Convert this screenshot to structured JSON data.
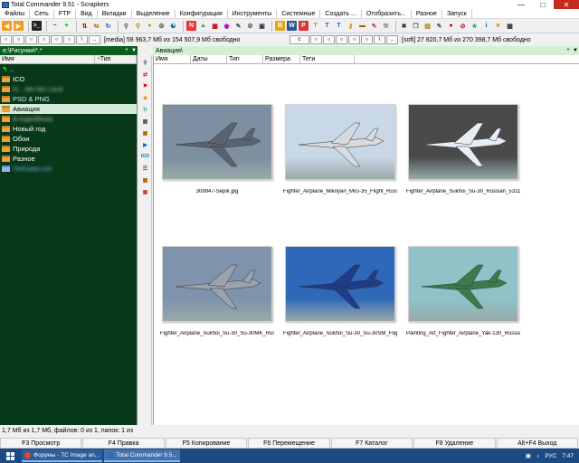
{
  "window": {
    "title": "Total Commander 9.51 - Scrapkers"
  },
  "menu": [
    "Файлы",
    "Сеть",
    "FTP",
    "Вид",
    "Вкладки",
    "Выделение",
    "Конфигурация",
    "Инструменты",
    "Системные",
    "Создать ...",
    "Отобразить...",
    "Разное",
    "Запуск"
  ],
  "left_drive": {
    "label": "c",
    "info": "[media]  58 963,7 Мб из 154 507,9 Мб свободно"
  },
  "right_drive": {
    "label": "c",
    "info": "[soft]  27 820,7 Мб из 270 398,7 Мб свободно"
  },
  "left_path": "e:\\Рисунки\\*.*",
  "right_path": "Авиация\\",
  "star_symbol": "*",
  "left_columns": {
    "name": "Имя",
    "type": "Тип"
  },
  "right_columns": {
    "name": "Имя",
    "date": "Даты",
    "type": "Тип",
    "size": "Размера",
    "tags": "Теги"
  },
  "left_files": [
    {
      "name": "..",
      "kind": "up"
    },
    {
      "name": "ICO",
      "kind": "folder"
    },
    {
      "name": "N... Mo Mo Land",
      "kind": "folder",
      "blurred": true
    },
    {
      "name": "PSD & PNG",
      "kind": "folder"
    },
    {
      "name": "Авиация",
      "kind": "folder",
      "selected": true
    },
    {
      "name": "В.Коробёнка",
      "kind": "folder",
      "blurred": true
    },
    {
      "name": "Новый год",
      "kind": "folder"
    },
    {
      "name": "Обои",
      "kind": "folder"
    },
    {
      "name": "Природа",
      "kind": "folder"
    },
    {
      "name": "Разное",
      "kind": "folder"
    },
    {
      "name": "Пейзажи.net",
      "kind": "file",
      "blurred": true
    }
  ],
  "thumbnails": [
    {
      "label": "309947-Sepik.jpg",
      "sky": "#7d8fa0",
      "plane": "#5a6470"
    },
    {
      "label": "Fighter_Airplane_Mikoyan_MiG-35_Flight_Russia...",
      "sky": "#c9d8e6",
      "plane": "#d7dbdf"
    },
    {
      "label": "Fighter_Airplane_Sukhoi_Su-30_Russian_531120_...",
      "sky": "#4a4a4a",
      "plane": "#e8eef5"
    },
    {
      "label": "Fighter_Airplane_Sukhoi_Su-30_Su-30MK_Russia...",
      "sky": "#7f93ac",
      "plane": "#9aa3ad"
    },
    {
      "label": "Fighter_Airplane_Sukhoi_Su-30_Su-30SM_Flight_...",
      "sky": "#2f68b8",
      "plane": "#1e3c8a"
    },
    {
      "label": "Painting_Art_Fighter_Airplane_Yak-130_Russian_...",
      "sky": "#8fc3c8",
      "plane": "#3d7a4b"
    }
  ],
  "status_left": "1,7 Мб из 1,7 Мб, файлов: 0 из 1, папок: 1 из",
  "fkeys": [
    "F3 Просмотр",
    "F4 Правка",
    "F5 Копирование",
    "F6 Перемещение",
    "F7 Каталог",
    "F8 Удаление",
    "Alt+F4 Выход"
  ],
  "taskbar": {
    "tasks": [
      {
        "label": "Форумы - TC Image an...",
        "color": "#e04a2a"
      },
      {
        "label": "Total Commander 9.5...",
        "color": "#2e6db4",
        "active": true
      }
    ],
    "lang": "РУС",
    "time": "7:47"
  }
}
